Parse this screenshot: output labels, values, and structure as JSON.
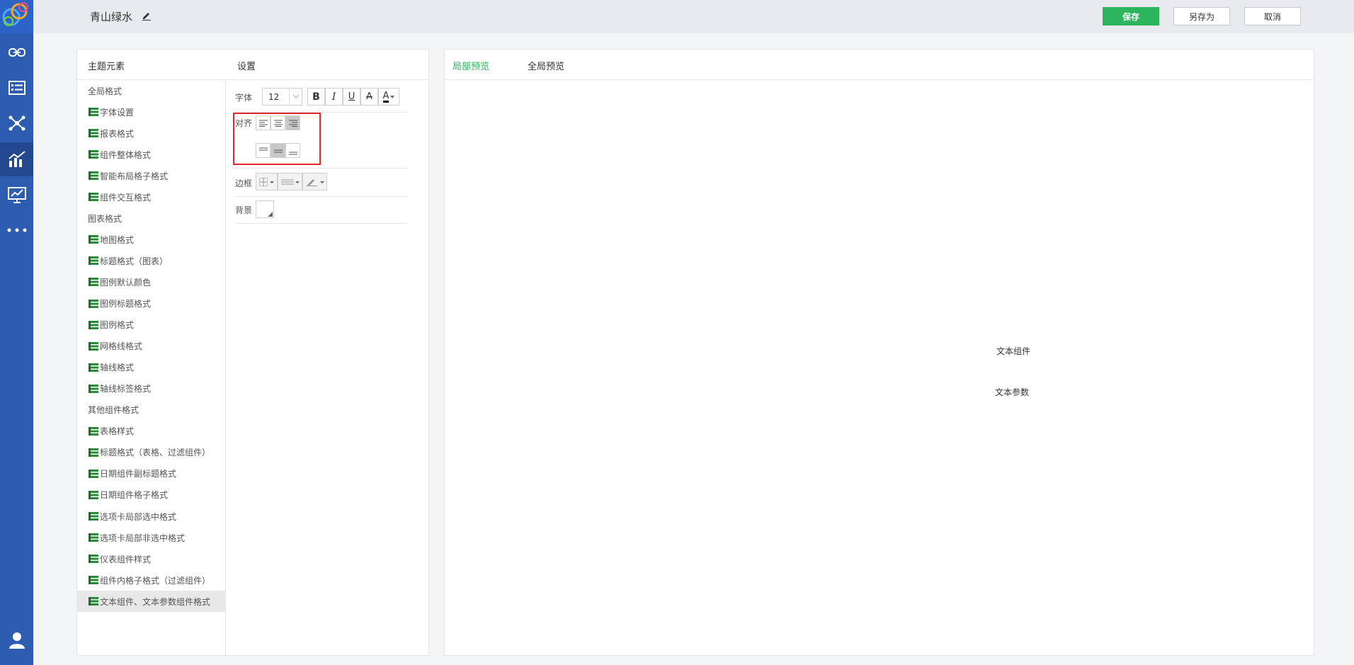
{
  "header": {
    "title": "青山绿水",
    "save_label": "保存",
    "saveas_label": "另存为",
    "cancel_label": "取消"
  },
  "left_panel": {
    "elements_title": "主题元素",
    "settings_title": "设置",
    "tree": [
      {
        "label": "全局格式",
        "type": "group"
      },
      {
        "label": "字体设置",
        "type": "leaf"
      },
      {
        "label": "报表格式",
        "type": "leaf"
      },
      {
        "label": "组件整体格式",
        "type": "leaf"
      },
      {
        "label": "智能布局格子格式",
        "type": "leaf"
      },
      {
        "label": "组件交互格式",
        "type": "leaf"
      },
      {
        "label": "图表格式",
        "type": "group"
      },
      {
        "label": "地图格式",
        "type": "leaf"
      },
      {
        "label": "标题格式（图表）",
        "type": "leaf"
      },
      {
        "label": "图例默认颜色",
        "type": "leaf"
      },
      {
        "label": "图例标题格式",
        "type": "leaf"
      },
      {
        "label": "图例格式",
        "type": "leaf"
      },
      {
        "label": "网格线格式",
        "type": "leaf"
      },
      {
        "label": "轴线格式",
        "type": "leaf"
      },
      {
        "label": "轴线标签格式",
        "type": "leaf"
      },
      {
        "label": "其他组件格式",
        "type": "group"
      },
      {
        "label": "表格样式",
        "type": "leaf"
      },
      {
        "label": "标题格式（表格、过滤组件）",
        "type": "leaf"
      },
      {
        "label": "日期组件副标题格式",
        "type": "leaf"
      },
      {
        "label": "日期组件格子格式",
        "type": "leaf"
      },
      {
        "label": "选项卡局部选中格式",
        "type": "leaf"
      },
      {
        "label": "选项卡局部非选中格式",
        "type": "leaf"
      },
      {
        "label": "仪表组件样式",
        "type": "leaf"
      },
      {
        "label": "组件内格子格式（过滤组件）",
        "type": "leaf"
      },
      {
        "label": "文本组件、文本参数组件格式",
        "type": "leaf",
        "selected": true
      }
    ],
    "settings": {
      "font_label": "字体",
      "font_size": "12",
      "align_label": "对齐",
      "border_label": "边框",
      "background_label": "背景",
      "bold": "B",
      "italic": "I",
      "underline": "U",
      "strike": "A",
      "color_a": "A"
    }
  },
  "right_panel": {
    "tab_local": "局部预览",
    "tab_global": "全局预览",
    "preview_text_component": "文本组件",
    "preview_text_param": "文本参数"
  },
  "colors": {
    "nav": "#2d5cb0",
    "accent": "#2db55d",
    "highlight": "#e02a2a"
  }
}
